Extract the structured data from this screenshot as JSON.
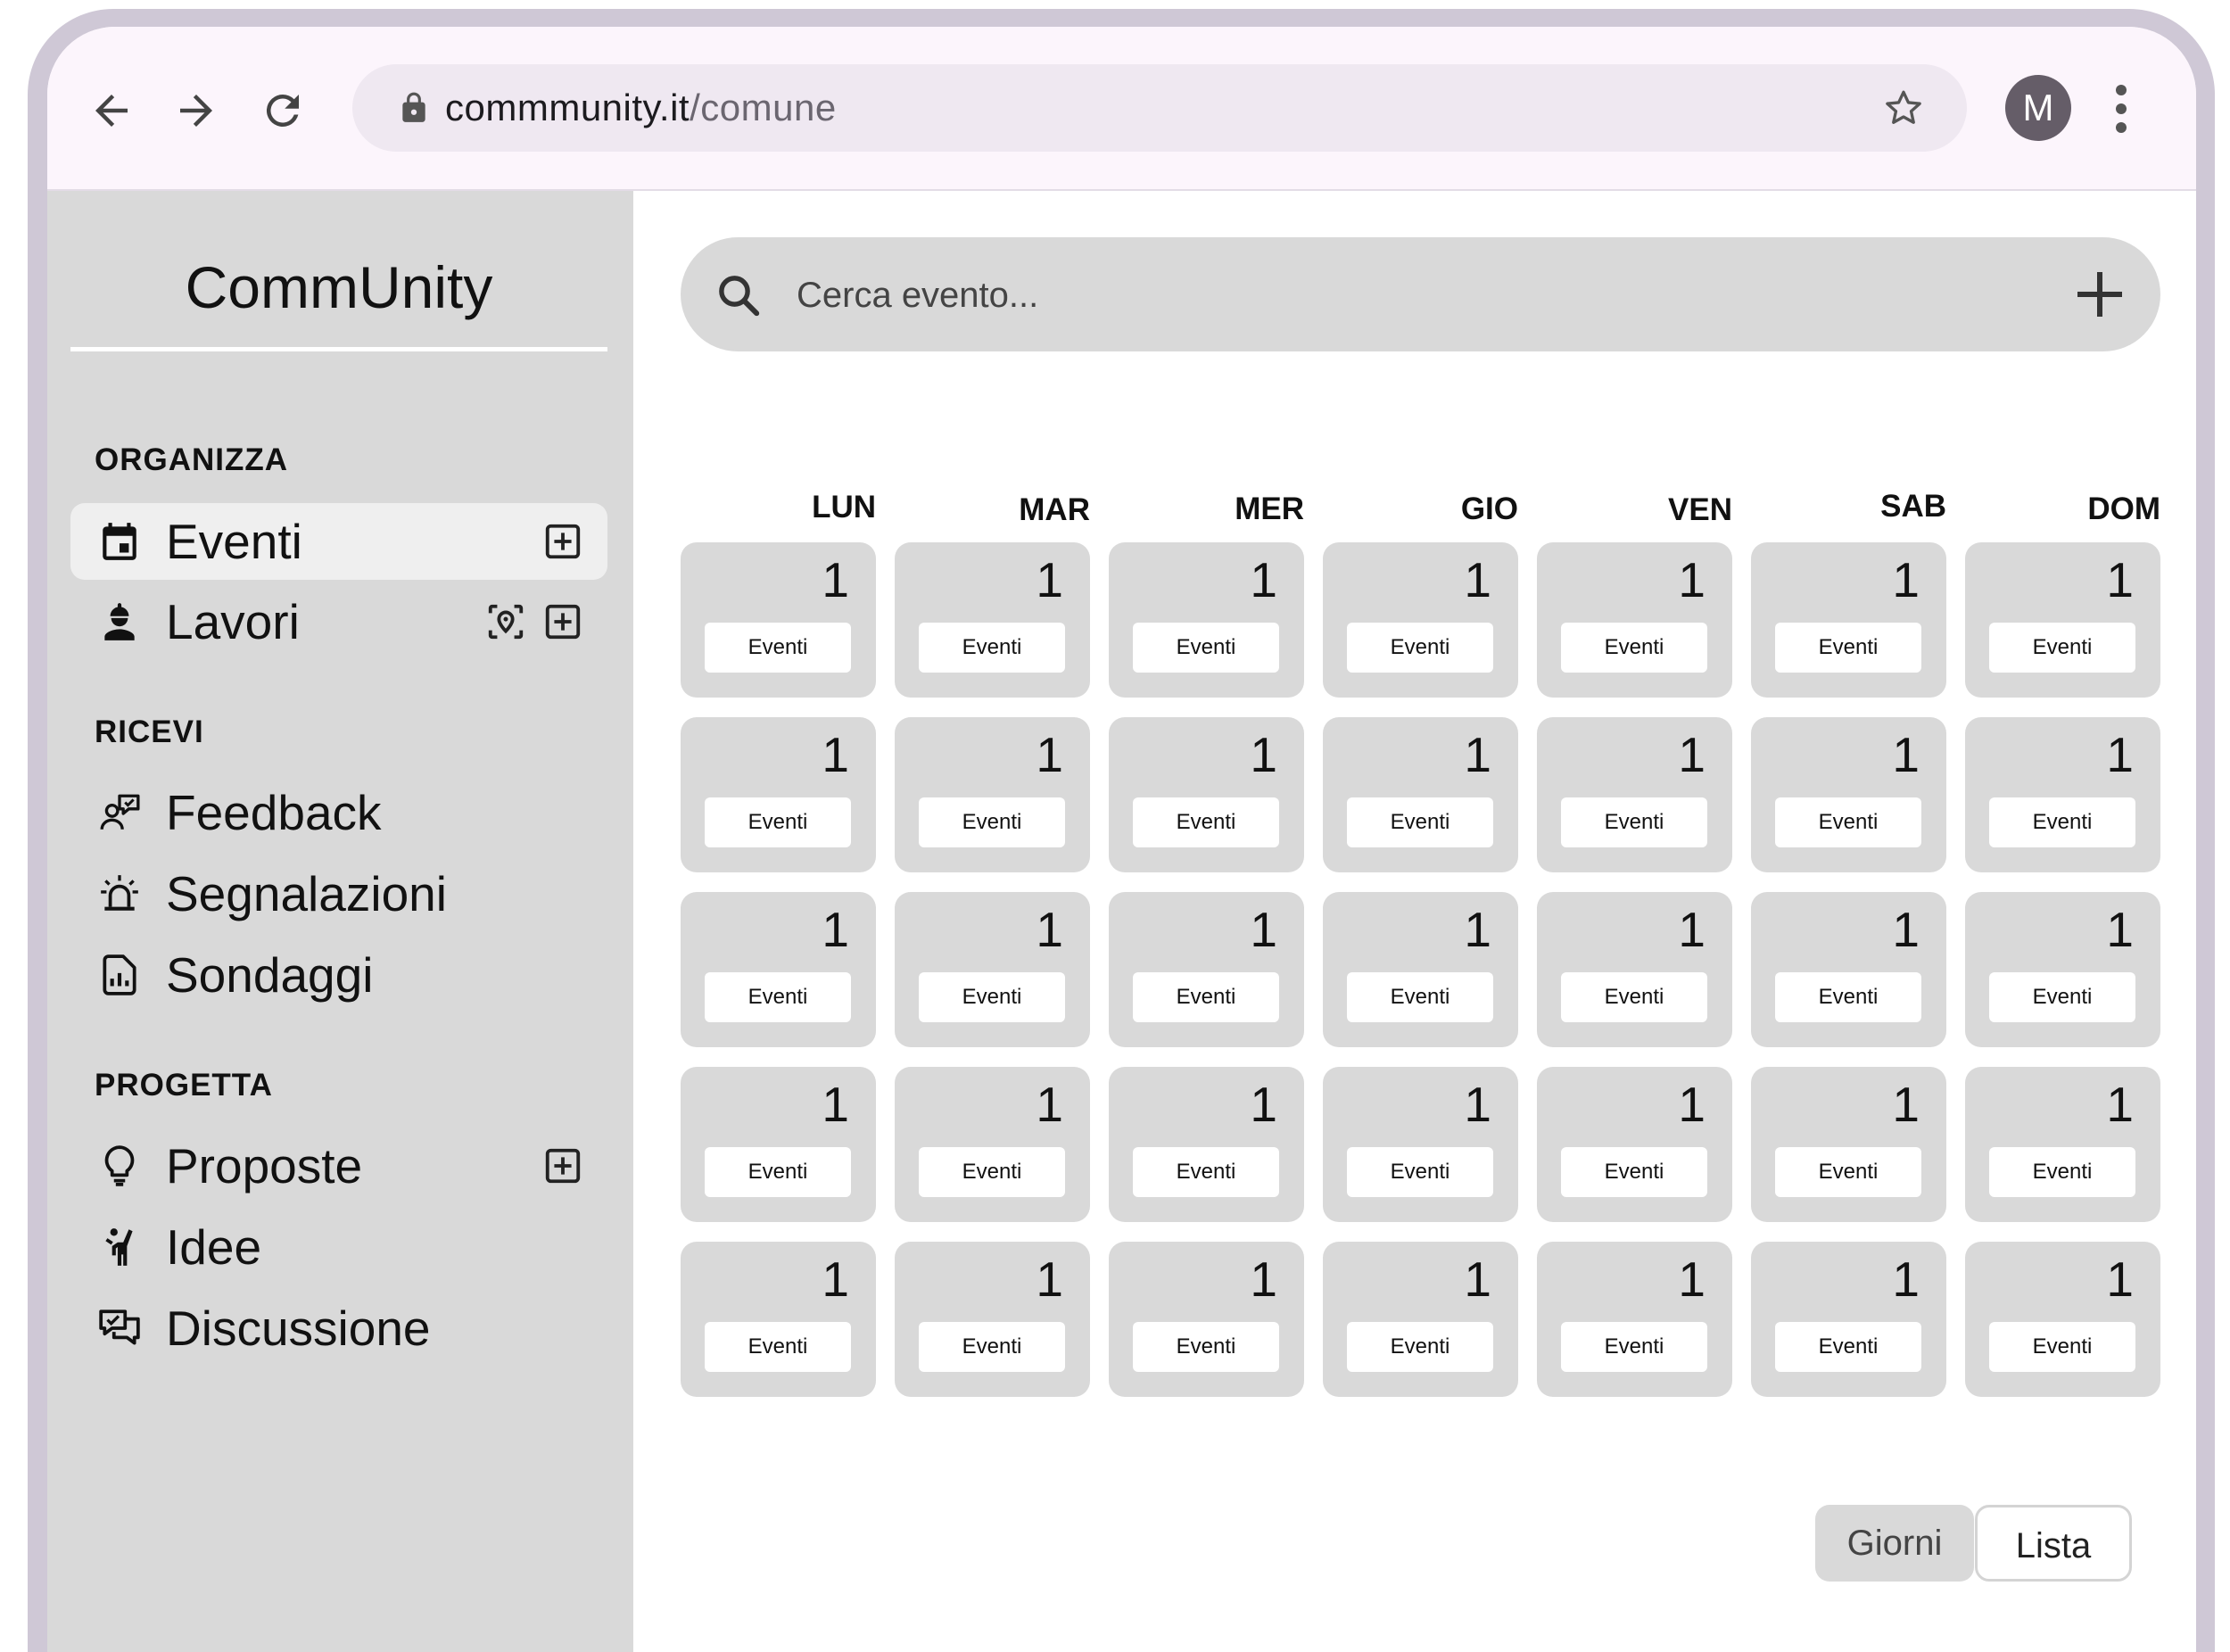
{
  "browser": {
    "url_host": "commmunity.it",
    "url_path": "/comune",
    "avatar_letter": "M"
  },
  "sidebar": {
    "brand": "CommUnity",
    "sections": [
      {
        "title": "ORGANIZZA",
        "items": [
          {
            "label": "Eventi",
            "icon": "calendar-icon",
            "active": true
          },
          {
            "label": "Lavori",
            "icon": "worker-icon"
          }
        ]
      },
      {
        "title": "RICEVI",
        "items": [
          {
            "label": "Feedback",
            "icon": "feedback-icon"
          },
          {
            "label": "Segnalazioni",
            "icon": "alarm-icon"
          },
          {
            "label": "Sondaggi",
            "icon": "poll-icon"
          }
        ]
      },
      {
        "title": "PROGETTA",
        "items": [
          {
            "label": "Proposte",
            "icon": "lightbulb-icon"
          },
          {
            "label": "Idee",
            "icon": "person-raise-hand-icon"
          },
          {
            "label": "Discussione",
            "icon": "chat-icon"
          }
        ]
      }
    ]
  },
  "search": {
    "placeholder": "Cerca evento..."
  },
  "calendar": {
    "days": [
      "LUN",
      "MAR",
      "MER",
      "GIO",
      "VEN",
      "SAB",
      "DOM"
    ],
    "weeks": [
      [
        {
          "day": "1",
          "tag": "Eventi"
        },
        {
          "day": "1",
          "tag": "Eventi"
        },
        {
          "day": "1",
          "tag": "Eventi"
        },
        {
          "day": "1",
          "tag": "Eventi"
        },
        {
          "day": "1",
          "tag": "Eventi"
        },
        {
          "day": "1",
          "tag": "Eventi"
        },
        {
          "day": "1",
          "tag": "Eventi"
        }
      ],
      [
        {
          "day": "1",
          "tag": "Eventi"
        },
        {
          "day": "1",
          "tag": "Eventi"
        },
        {
          "day": "1",
          "tag": "Eventi"
        },
        {
          "day": "1",
          "tag": "Eventi"
        },
        {
          "day": "1",
          "tag": "Eventi"
        },
        {
          "day": "1",
          "tag": "Eventi"
        },
        {
          "day": "1",
          "tag": "Eventi"
        }
      ],
      [
        {
          "day": "1",
          "tag": "Eventi"
        },
        {
          "day": "1",
          "tag": "Eventi"
        },
        {
          "day": "1",
          "tag": "Eventi"
        },
        {
          "day": "1",
          "tag": "Eventi"
        },
        {
          "day": "1",
          "tag": "Eventi"
        },
        {
          "day": "1",
          "tag": "Eventi"
        },
        {
          "day": "1",
          "tag": "Eventi"
        }
      ],
      [
        {
          "day": "1",
          "tag": "Eventi"
        },
        {
          "day": "1",
          "tag": "Eventi"
        },
        {
          "day": "1",
          "tag": "Eventi"
        },
        {
          "day": "1",
          "tag": "Eventi"
        },
        {
          "day": "1",
          "tag": "Eventi"
        },
        {
          "day": "1",
          "tag": "Eventi"
        },
        {
          "day": "1",
          "tag": "Eventi"
        }
      ],
      [
        {
          "day": "1",
          "tag": "Eventi"
        },
        {
          "day": "1",
          "tag": "Eventi"
        },
        {
          "day": "1",
          "tag": "Eventi"
        },
        {
          "day": "1",
          "tag": "Eventi"
        },
        {
          "day": "1",
          "tag": "Eventi"
        },
        {
          "day": "1",
          "tag": "Eventi"
        },
        {
          "day": "1",
          "tag": "Eventi"
        }
      ]
    ]
  },
  "view_toggle": {
    "days_label": "Giorni",
    "list_label": "Lista",
    "selected": "Giorni"
  }
}
